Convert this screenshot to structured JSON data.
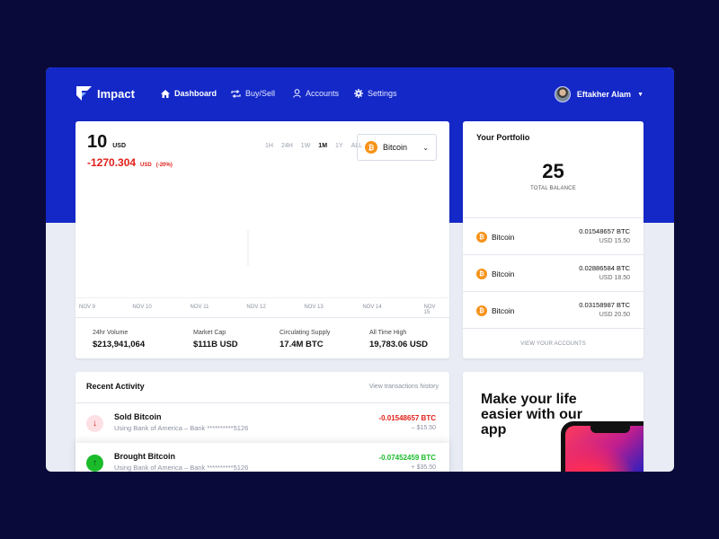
{
  "brand": {
    "name": "Impact"
  },
  "nav": {
    "items": [
      {
        "label": "Dashboard",
        "icon": "home-icon",
        "active": true
      },
      {
        "label": "Buy/Sell",
        "icon": "repeat-icon",
        "active": false
      },
      {
        "label": "Accounts",
        "icon": "user-icon",
        "active": false
      },
      {
        "label": "Settings",
        "icon": "gear-icon",
        "active": false
      }
    ],
    "user": {
      "name": "Eftakher Alam"
    }
  },
  "chart": {
    "price": "10",
    "price_unit": "USD",
    "change": "-1270.304",
    "change_unit": "USD",
    "change_pct": "(-20%)",
    "ranges": [
      "1H",
      "24H",
      "1W",
      "1M",
      "1Y",
      "ALL"
    ],
    "active_range": "1M",
    "coin": "Bitcoin",
    "x_ticks": [
      "NOV 9",
      "NOV 10",
      "NOV 11",
      "NOV 12",
      "NOV 13",
      "NOV 14",
      "NOV 15"
    ],
    "stats": [
      {
        "label": "24hr Volume",
        "value": "$213,941,064"
      },
      {
        "label": "Market Cap",
        "value": "$111B USD"
      },
      {
        "label": "Circulating Supply",
        "value": "17.4M BTC"
      },
      {
        "label": "All Time High",
        "value": "19,783.06 USD"
      }
    ]
  },
  "portfolio": {
    "title": "Your Portfolio",
    "balance": "25",
    "balance_label": "TOTAL BALANCE",
    "holdings": [
      {
        "name": "Bitcoin",
        "btc": "0.01548657 BTC",
        "usd": "USD 15.50"
      },
      {
        "name": "Bitcoin",
        "btc": "0.02886584 BTC",
        "usd": "USD 18.50"
      },
      {
        "name": "Bitcoin",
        "btc": "0.03158987 BTC",
        "usd": "USD 20.50"
      }
    ],
    "view_accounts": "VIEW YOUR ACCOUNTS"
  },
  "activity": {
    "title": "Recent Activity",
    "history_link": "View transactions history",
    "rows": [
      {
        "title": "Sold Bitcoin",
        "subtitle": "Using Bank of America – Bank **********5126",
        "btc": "-0.01548657 BTC",
        "usd": "– $15.50"
      },
      {
        "title": "Brought Bitcoin",
        "subtitle": "Using Bank of America – Bank **********5126",
        "btc": "-0.07452459 BTC",
        "usd": "+ $35.50"
      }
    ]
  },
  "promo": {
    "text": "Make your life easier with our app"
  },
  "colors": {
    "background": "#0a0a3a",
    "brand_blue": "#1428c8",
    "negative": "#e0201a",
    "positive": "#1bbb2b",
    "bitcoin": "#f7931a"
  }
}
